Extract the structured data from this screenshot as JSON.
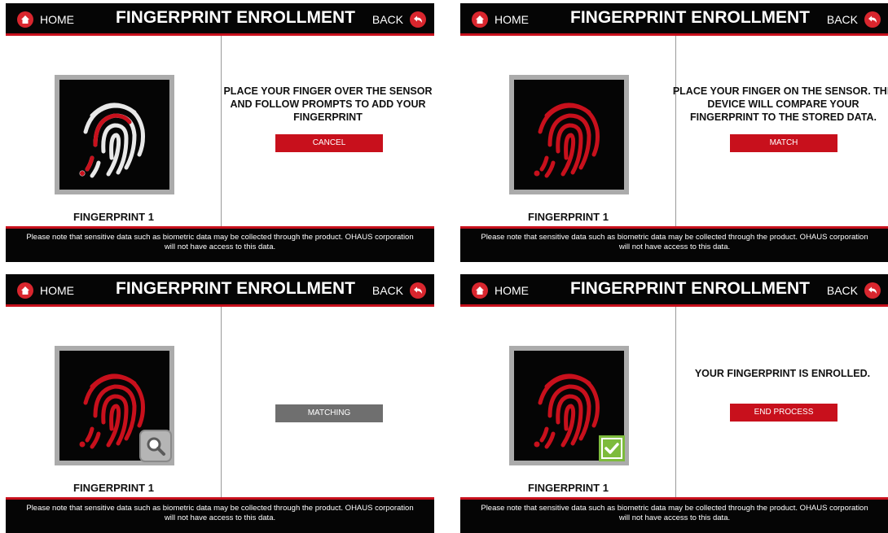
{
  "colors": {
    "accent": "#c8101c",
    "header_bg": "#050505",
    "check_green": "#7dbb3c",
    "matching_gray": "#6f6f6f"
  },
  "screens": [
    {
      "header": {
        "home_label": "HOME",
        "title": "FINGERPRINT ENROLLMENT",
        "back_label": "BACK",
        "home_icon": "home-icon",
        "back_icon": "back-arrow-icon"
      },
      "fingerprint_caption": "FINGERPRINT 1",
      "fingerprint_state": "scanning",
      "message_lines": [
        "PLACE YOUR FINGER OVER THE SENSOR",
        "AND FOLLOW PROMPTS TO ADD YOUR",
        "FINGERPRINT"
      ],
      "button_label": "CANCEL",
      "footer_lines": [
        "Please note that sensitive data such as biometric data may be collected through the product. OHAUS corporation",
        "will not have access to this data."
      ]
    },
    {
      "header": {
        "home_label": "HOME",
        "title": "FINGERPRINT ENROLLMENT",
        "back_label": "BACK",
        "home_icon": "home-icon",
        "back_icon": "back-arrow-icon"
      },
      "fingerprint_caption": "FINGERPRINT 1",
      "fingerprint_state": "captured",
      "message_lines": [
        "PLACE YOUR FINGER ON THE SENSOR. THE",
        "DEVICE WILL COMPARE YOUR",
        "FINGERPRINT TO THE STORED DATA."
      ],
      "button_label": "MATCH",
      "footer_lines": [
        "Please note that sensitive data such as biometric data may be collected through the product. OHAUS corporation",
        "will not have access to this data."
      ]
    },
    {
      "header": {
        "home_label": "HOME",
        "title": "FINGERPRINT ENROLLMENT",
        "back_label": "BACK",
        "home_icon": "home-icon",
        "back_icon": "back-arrow-icon"
      },
      "fingerprint_caption": "FINGERPRINT 1",
      "fingerprint_state": "matching",
      "badge_icon": "magnifier-icon",
      "message_lines": [],
      "button_label": "MATCHING",
      "footer_lines": [
        "Please note that sensitive data such as biometric data may be collected through the product. OHAUS corporation",
        "will not have access to this data."
      ]
    },
    {
      "header": {
        "home_label": "HOME",
        "title": "FINGERPRINT ENROLLMENT",
        "back_label": "BACK",
        "home_icon": "home-icon",
        "back_icon": "back-arrow-icon"
      },
      "fingerprint_caption": "FINGERPRINT 1",
      "fingerprint_state": "enrolled",
      "badge_icon": "checkmark-icon",
      "message_lines": [
        "YOUR FINGERPRINT IS ENROLLED."
      ],
      "button_label": "END PROCESS",
      "footer_lines": [
        "Please note that sensitive data such as biometric data may be collected through the product. OHAUS corporation",
        "will not have access to this data."
      ]
    }
  ]
}
